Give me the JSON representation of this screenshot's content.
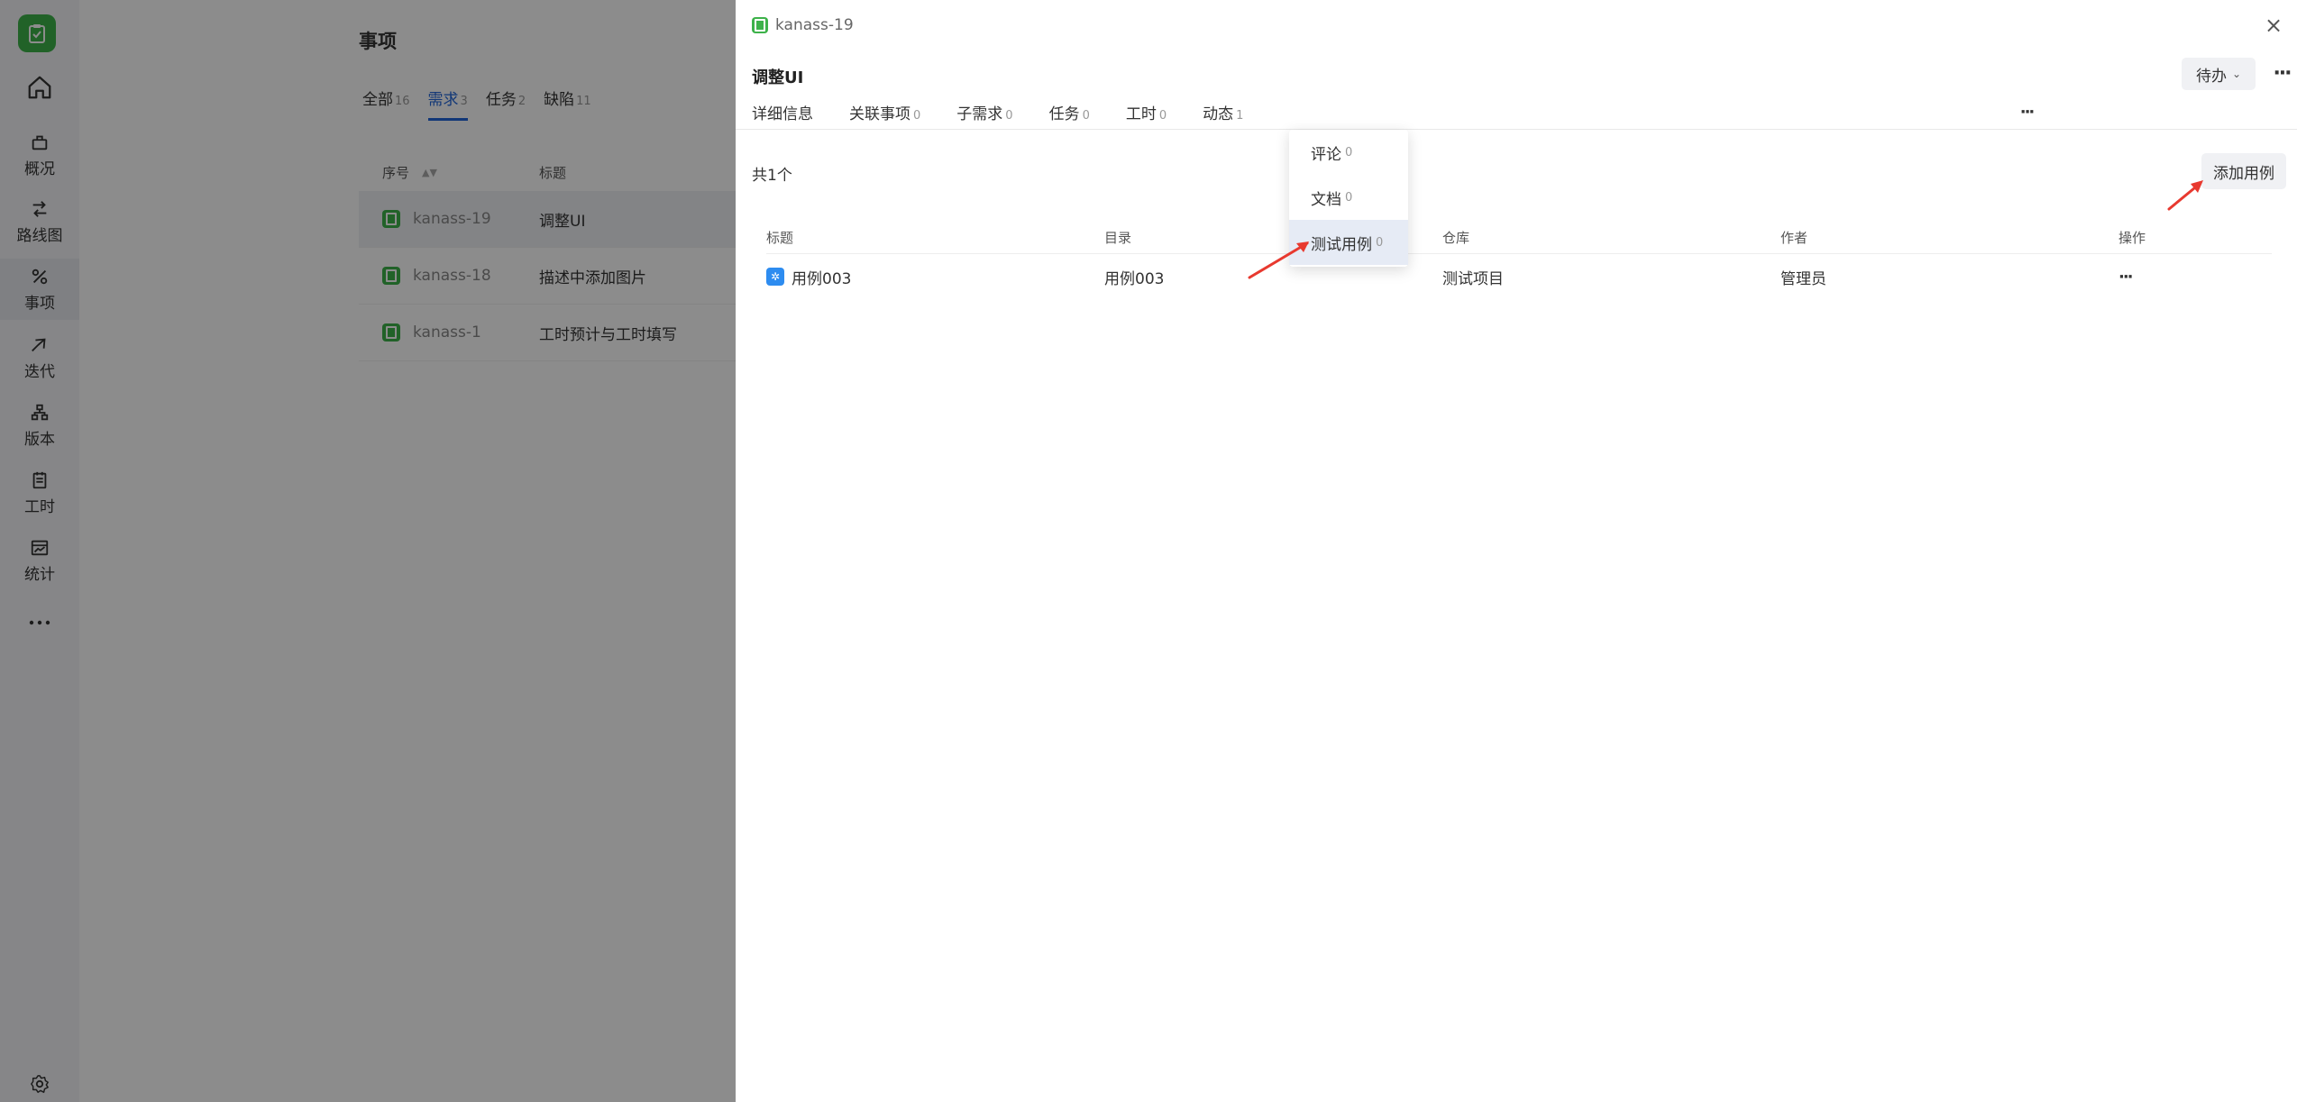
{
  "nav": {
    "items": [
      {
        "label": "概况",
        "icon": "briefcase-icon"
      },
      {
        "label": "路线图",
        "icon": "route-icon"
      },
      {
        "label": "事项",
        "icon": "issue-icon"
      },
      {
        "label": "迭代",
        "icon": "sprint-icon"
      },
      {
        "label": "版本",
        "icon": "version-icon"
      },
      {
        "label": "工时",
        "icon": "timesheet-icon"
      },
      {
        "label": "统计",
        "icon": "statistics-icon"
      }
    ]
  },
  "background": {
    "title": "事项",
    "tabs": [
      {
        "label": "全部",
        "count": "16"
      },
      {
        "label": "需求",
        "count": "3"
      },
      {
        "label": "任务",
        "count": "2"
      },
      {
        "label": "缺陷",
        "count": "11"
      }
    ],
    "table": {
      "headers": [
        "序号",
        "标题"
      ],
      "rows": [
        {
          "key": "kanass-19",
          "title": "调整UI"
        },
        {
          "key": "kanass-18",
          "title": "描述中添加图片"
        },
        {
          "key": "kanass-1",
          "title": "工时预计与工时填写"
        }
      ]
    }
  },
  "drawer": {
    "key": "kanass-19",
    "title": "调整UI",
    "status": "待办",
    "tabs": [
      {
        "label": "详细信息",
        "count": ""
      },
      {
        "label": "关联事项",
        "count": "0"
      },
      {
        "label": "子需求",
        "count": "0"
      },
      {
        "label": "任务",
        "count": "0"
      },
      {
        "label": "工时",
        "count": "0"
      },
      {
        "label": "动态",
        "count": "1"
      }
    ],
    "count_text": "共1个",
    "add_button": "添加用例",
    "table": {
      "headers": [
        "标题",
        "目录",
        "仓库",
        "作者",
        "操作"
      ],
      "rows": [
        {
          "title": "用例003",
          "directory": "用例003",
          "repository": "测试项目",
          "author": "管理员"
        }
      ]
    }
  },
  "dropdown": {
    "items": [
      {
        "label": "评论",
        "count": "0"
      },
      {
        "label": "文档",
        "count": "0"
      },
      {
        "label": "测试用例",
        "count": "0"
      }
    ]
  },
  "colors": {
    "brand_green": "#3db24a",
    "accent_blue": "#1f64d9",
    "arrow_red": "#e8392f"
  }
}
